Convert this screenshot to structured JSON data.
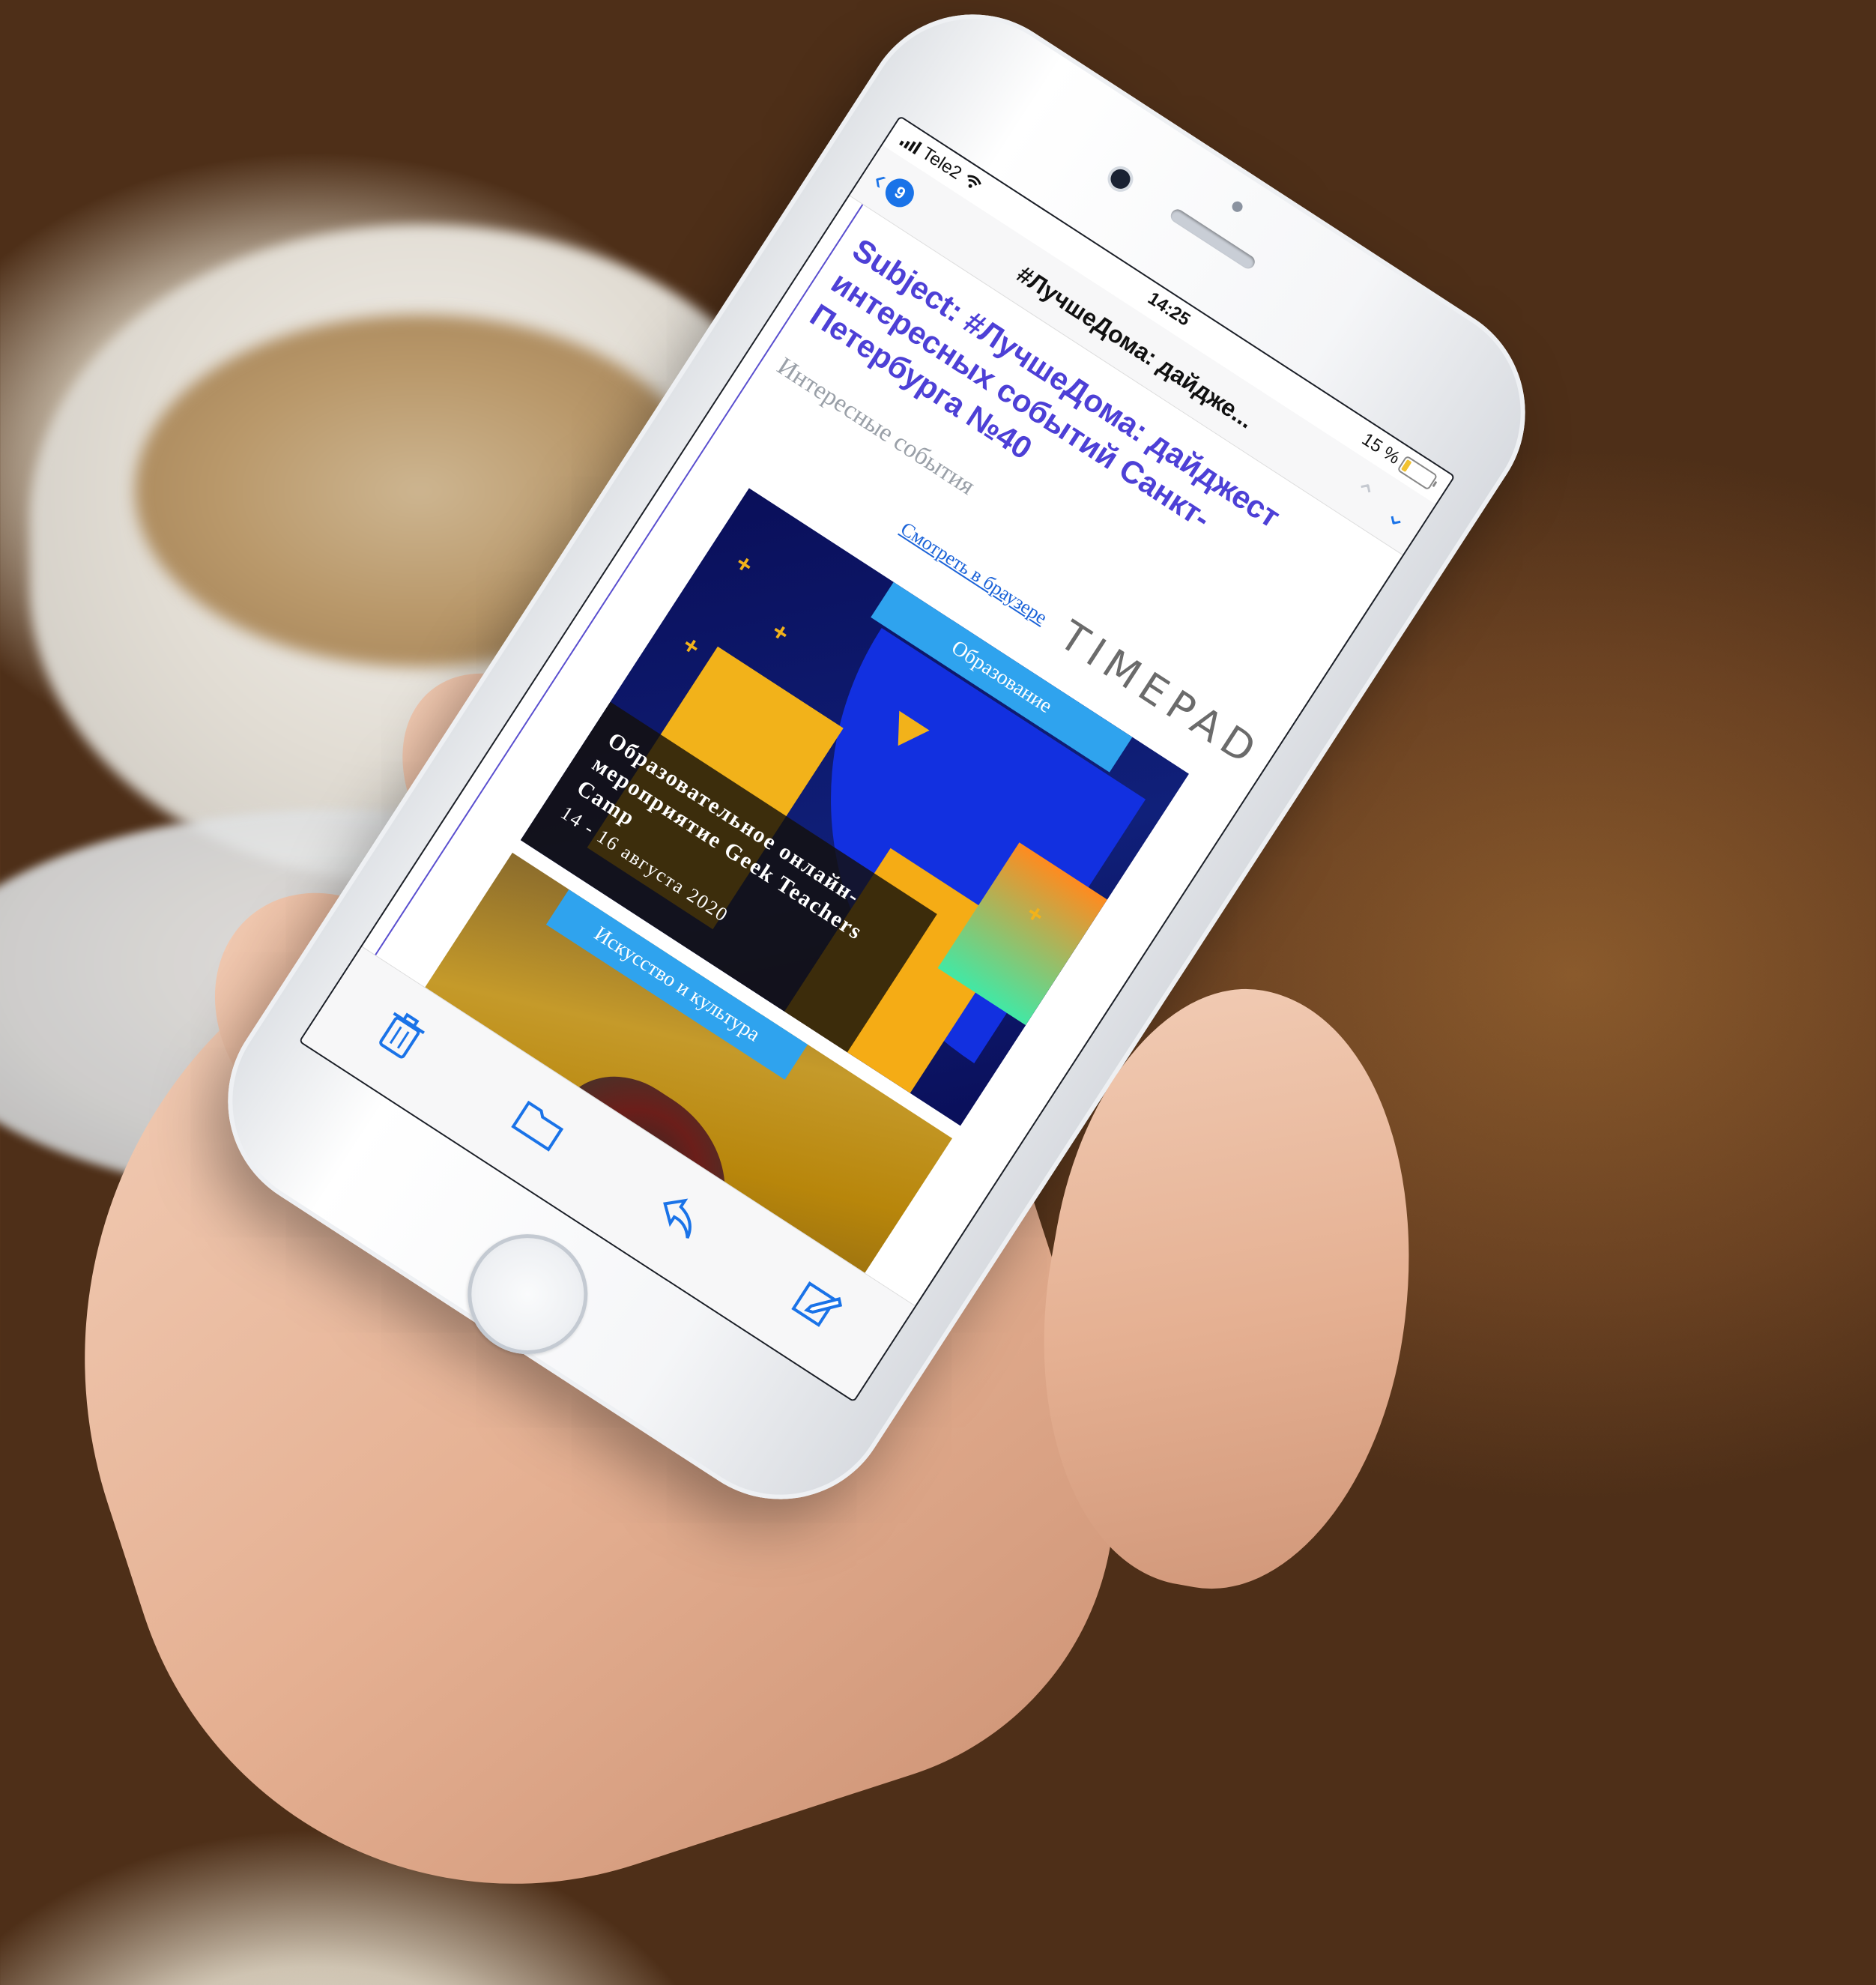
{
  "status_bar": {
    "carrier": "Tele2",
    "time": "14:25",
    "battery_text": "15 %",
    "battery_level": 0.15
  },
  "navigation": {
    "back_count": "9",
    "title": "#ЛучшеДома: дайдже...",
    "prev_icon": "chevron-up-icon",
    "next_icon": "chevron-down-icon"
  },
  "email": {
    "subject": "Subject: #ЛучшеДома: дайджест интересных событий Санкт-Петербурга №40",
    "preheader": "Интересные события",
    "view_in_browser": "Смотреть в браузере",
    "brand_logo_text": "TIMEPAD",
    "cards": [
      {
        "category": "Образование",
        "title": "Образовательное онлайн-мероприятие Geek Teachers Camp",
        "dates": "14 - 16 августа 2020"
      },
      {
        "category": "Искусство и культура"
      }
    ]
  },
  "toolbar": {
    "items": [
      "trash-icon",
      "folder-icon",
      "reply-icon",
      "compose-icon"
    ]
  },
  "colors": {
    "accent": "#1a73e8",
    "subject": "#4d40d6",
    "tag": "#2fa3ee"
  }
}
